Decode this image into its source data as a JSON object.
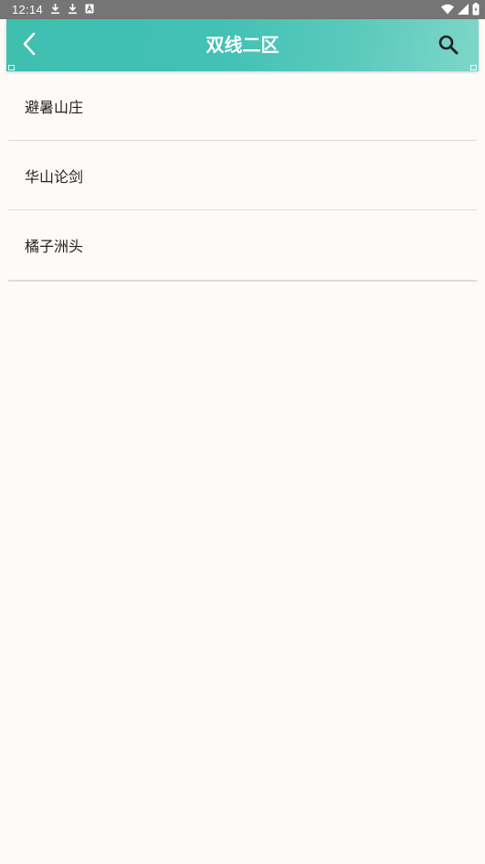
{
  "status_bar": {
    "time": "12:14",
    "left_icons": [
      "download-icon",
      "download-icon",
      "text-a-icon"
    ],
    "right_icons": [
      "wifi-icon",
      "signal-icon",
      "battery-icon"
    ]
  },
  "app_bar": {
    "title": "双线二区",
    "back_icon": "chevron-left-icon",
    "search_icon": "search-icon"
  },
  "list": {
    "items": [
      {
        "label": "避暑山庄"
      },
      {
        "label": "华山论剑"
      },
      {
        "label": "橘子洲头"
      }
    ]
  },
  "colors": {
    "status_bar": "#757575",
    "app_bar_start": "#3ebfb0",
    "app_bar_end": "#7fd6ca",
    "page_background": "#fdfaf8",
    "divider": "#dcdcdc",
    "item_text": "#222222"
  }
}
